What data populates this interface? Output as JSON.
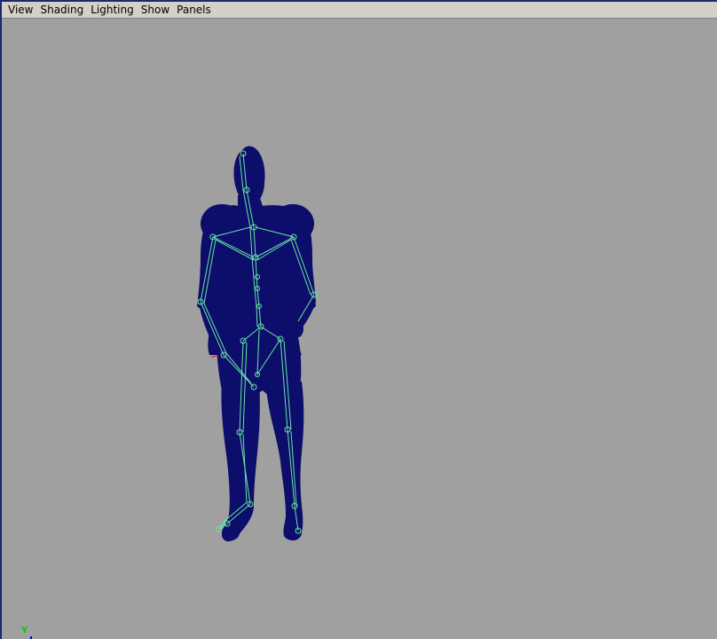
{
  "menubar": {
    "items": [
      {
        "label": "View"
      },
      {
        "label": "Shading"
      },
      {
        "label": "Lighting"
      },
      {
        "label": "Show"
      },
      {
        "label": "Panels"
      }
    ]
  },
  "viewport": {
    "background_color": "#a0a0a0",
    "model_color": "#0d0d6b",
    "skeleton_color": "#66e6a6",
    "axis_label": "Y",
    "axis_label_color": "#00cc00"
  }
}
